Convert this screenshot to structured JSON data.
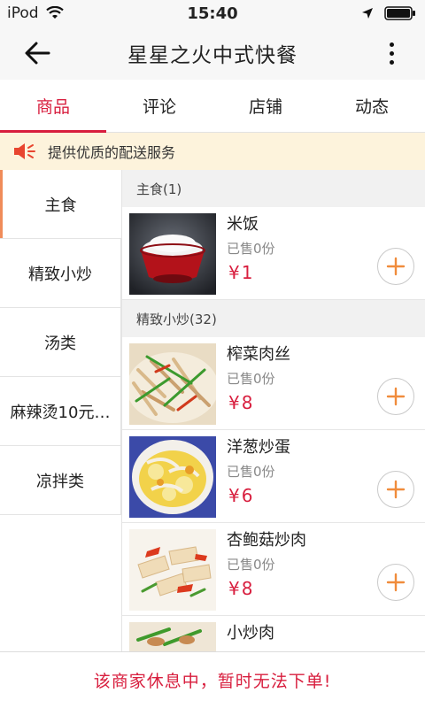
{
  "status_bar": {
    "carrier": "iPod",
    "time": "15:40"
  },
  "header": {
    "title": "星星之火中式快餐"
  },
  "tabs": [
    {
      "label": "商品",
      "active": true
    },
    {
      "label": "评论",
      "active": false
    },
    {
      "label": "店铺",
      "active": false
    },
    {
      "label": "动态",
      "active": false
    }
  ],
  "notice": {
    "text": "提供优质的配送服务"
  },
  "sidebar": {
    "items": [
      {
        "label": "主食",
        "active": true
      },
      {
        "label": "精致小炒",
        "active": false
      },
      {
        "label": "汤类",
        "active": false
      },
      {
        "label": "麻辣烫10元…",
        "active": false
      },
      {
        "label": "凉拌类",
        "active": false
      }
    ]
  },
  "sections": [
    {
      "title": "主食(1)",
      "items": [
        {
          "name": "米饭",
          "sold": "已售0份",
          "price": "¥1"
        }
      ]
    },
    {
      "title": "精致小炒(32)",
      "items": [
        {
          "name": "榨菜肉丝",
          "sold": "已售0份",
          "price": "¥8"
        },
        {
          "name": "洋葱炒蛋",
          "sold": "已售0份",
          "price": "¥6"
        },
        {
          "name": "杏鲍菇炒肉",
          "sold": "已售0份",
          "price": "¥8"
        },
        {
          "name": "小炒肉",
          "sold": "",
          "price": ""
        }
      ]
    }
  ],
  "footer": {
    "text": "该商家休息中，暂时无法下单!"
  },
  "colors": {
    "accent": "#d81e3e",
    "add_button": "#f08c3c",
    "notice_bg": "#fdf3dc"
  }
}
